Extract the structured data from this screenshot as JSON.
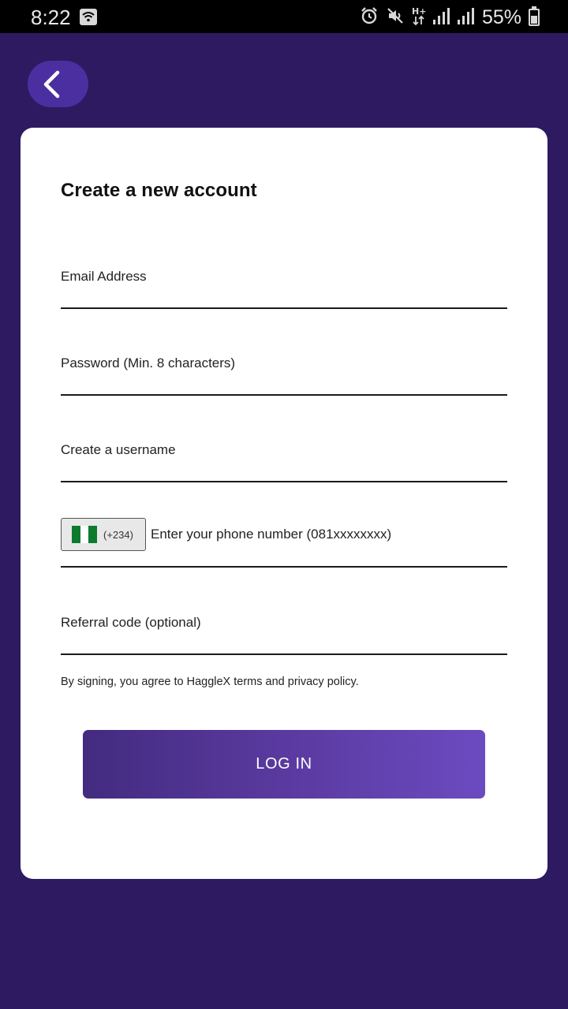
{
  "status_bar": {
    "time": "8:22",
    "battery_percent": "55%",
    "battery_level": 0.55,
    "icons": [
      "wifi-icon",
      "alarm-icon",
      "mute-icon",
      "h-plus-data-icon",
      "signal-icon",
      "signal-icon",
      "battery-icon"
    ]
  },
  "colors": {
    "background": "#2e1a61",
    "back_button": "#4b2fa0",
    "card": "#ffffff",
    "button_gradient_start": "#432b80",
    "button_gradient_end": "#6b4bc0"
  },
  "header": {
    "back_icon": "chevron-left-icon"
  },
  "form": {
    "title": "Create a new account",
    "email_label": "Email Address",
    "password_label": "Password (Min. 8 characters)",
    "username_label": "Create a username",
    "phone": {
      "country_code": "(+234)",
      "placeholder": "Enter your phone number (081xxxxxxxx)",
      "flag": "nigeria-flag-icon"
    },
    "referral_label": "Referral code (optional)",
    "terms": "By signing, you agree to HaggleX terms and privacy policy.",
    "submit_label": "LOG IN"
  }
}
